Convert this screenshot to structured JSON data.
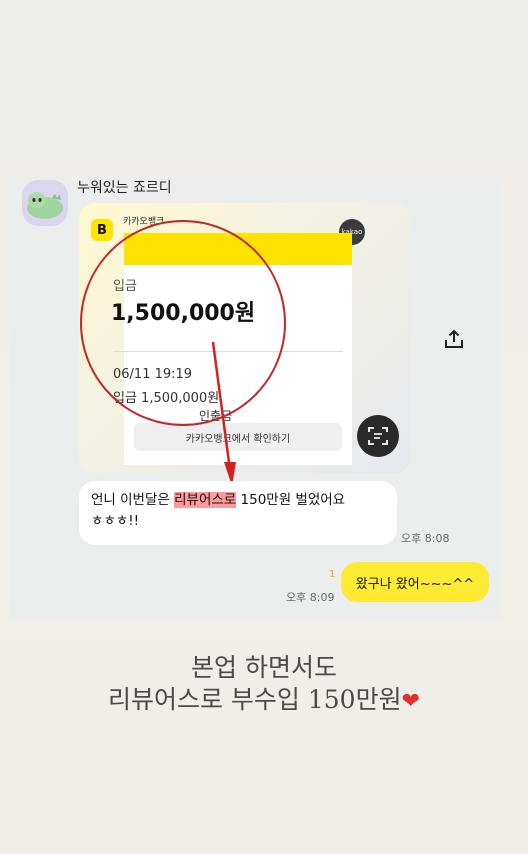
{
  "chat": {
    "sender_name": "누워있는 죠르디",
    "card": {
      "source_label": "카카오뱅크",
      "logo_letter": "B",
      "kakao_badge": "kakao",
      "deposit_label": "입금",
      "amount": "1,500,000원",
      "datetime": "06/11 19:19",
      "deposit_line": "입금 1,500,000원",
      "auth_line": "인출금",
      "confirm_button": "카카오뱅크에서 확인하기"
    },
    "message_left": {
      "text_before": "언니 이번달은 ",
      "highlight": "리뷰어스로",
      "text_after": " 150만원 벌었어요",
      "line2": "ㅎㅎㅎ!!",
      "time": "오후 8:08"
    },
    "message_right": {
      "text": "왔구나 왔어~~~^^",
      "unread_count": "1",
      "time": "오후 8:09"
    }
  },
  "caption": {
    "line1": "본업 하면서도",
    "line2": "리뷰어스로 부수입 150만원",
    "heart": "❤"
  },
  "colors": {
    "accent_yellow": "#ffe300",
    "bubble_yellow": "#ffeb33",
    "highlight_red": "#ff9a9a",
    "circle_red": "#c22a2a"
  }
}
